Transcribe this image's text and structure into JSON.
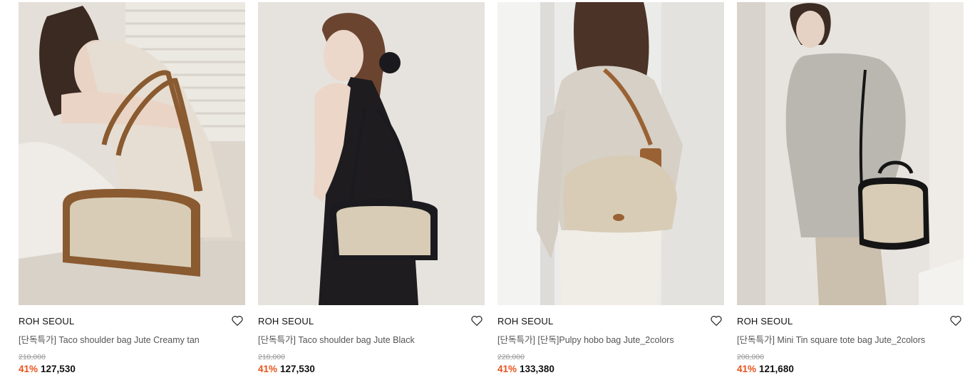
{
  "products": [
    {
      "brand": "ROH SEOUL",
      "name": "[단독특가] Taco shoulder bag Jute Creamy tan",
      "original_price": "218,000",
      "discount": "41%",
      "price": "127,530",
      "bag_trim_color": "#8a5a30"
    },
    {
      "brand": "ROH SEOUL",
      "name": "[단독특가] Taco shoulder bag Jute Black",
      "original_price": "218,000",
      "discount": "41%",
      "price": "127,530",
      "bag_trim_color": "#1b1b1f"
    },
    {
      "brand": "ROH SEOUL",
      "name": "[단독특가] [단독]Pulpy hobo bag Jute_2colors",
      "original_price": "228,000",
      "discount": "41%",
      "price": "133,380",
      "bag_trim_color": "#9a6234"
    },
    {
      "brand": "ROH SEOUL",
      "name": "[단독특가] Mini Tin square tote bag Jute_2colors",
      "original_price": "208,000",
      "discount": "41%",
      "price": "121,680",
      "bag_trim_color": "#151515"
    }
  ],
  "icons": {
    "wishlist": "heart-outline-icon"
  },
  "colors": {
    "discount": "#e8541e",
    "canvas": "#d8ccb6"
  }
}
